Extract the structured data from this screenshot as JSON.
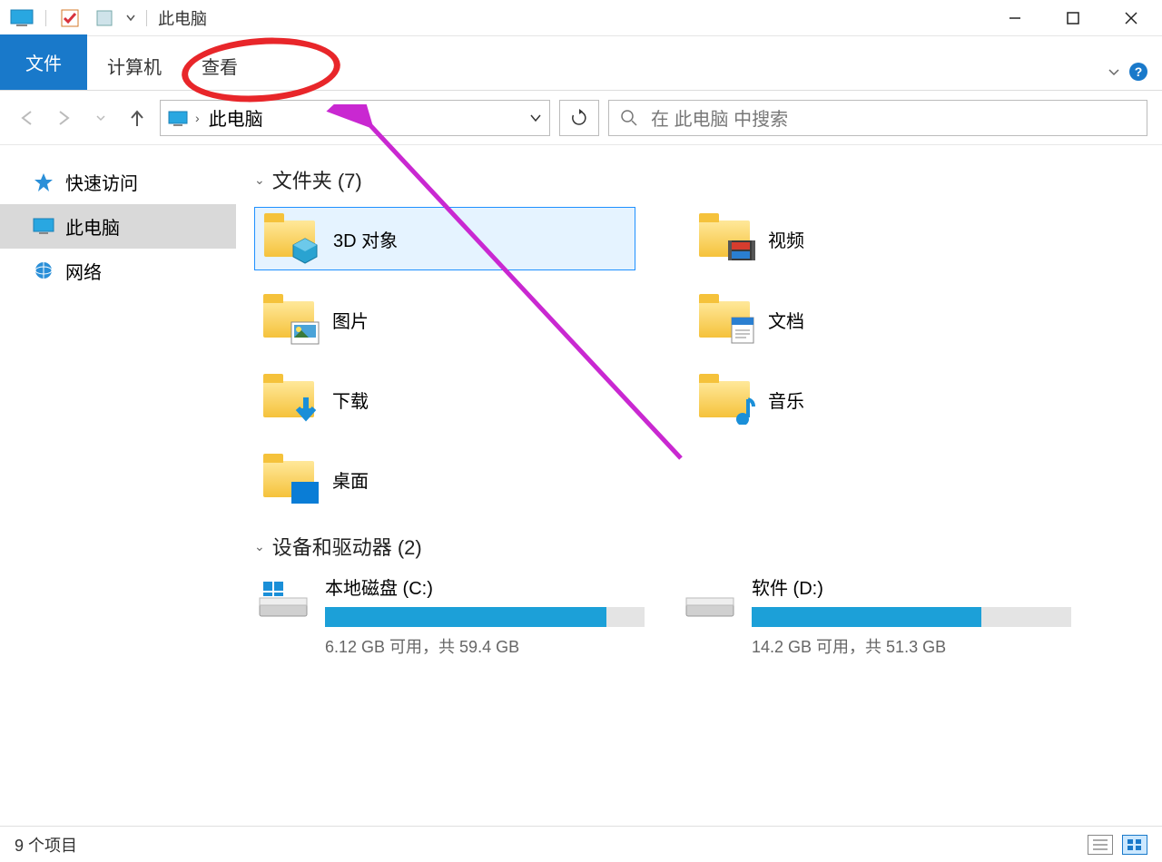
{
  "titlebar": {
    "title": "此电脑"
  },
  "ribbon": {
    "file": "文件",
    "computer": "计算机",
    "view": "查看"
  },
  "address": {
    "crumb": "此电脑",
    "search_placeholder": "在 此电脑 中搜索"
  },
  "sidebar": {
    "quick": "快速访问",
    "thispc": "此电脑",
    "network": "网络"
  },
  "sections": {
    "folders_h": "文件夹 (7)",
    "drives_h": "设备和驱动器 (2)"
  },
  "folders": [
    {
      "label": "3D 对象"
    },
    {
      "label": "视频"
    },
    {
      "label": "图片"
    },
    {
      "label": "文档"
    },
    {
      "label": "下载"
    },
    {
      "label": "音乐"
    },
    {
      "label": "桌面"
    }
  ],
  "drives": [
    {
      "name": "本地磁盘 (C:)",
      "free": "6.12 GB 可用，共 59.4 GB",
      "fill": 88
    },
    {
      "name": "软件 (D:)",
      "free": "14.2 GB 可用，共 51.3 GB",
      "fill": 72
    }
  ],
  "status": {
    "count": "9 个项目"
  }
}
